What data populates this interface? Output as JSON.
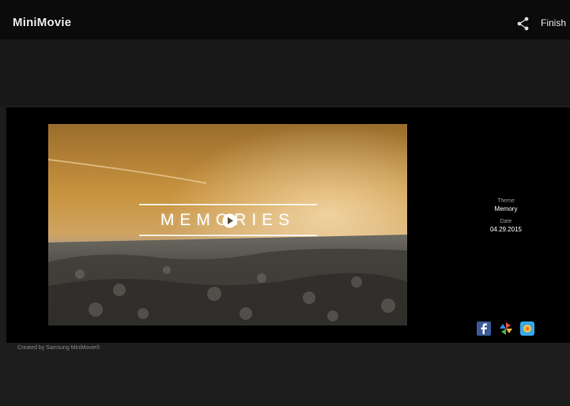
{
  "app": {
    "title": "MiniMovie",
    "finish_label": "Finish"
  },
  "video": {
    "overlay_title": "MEMORIES"
  },
  "info": {
    "theme_label": "Theme",
    "theme_value": "Memory",
    "date_label": "Date",
    "date_value": "04.29.2015"
  },
  "footer": {
    "credit": "Created by Samsung MiniMovie®"
  },
  "icons": {
    "share": "share-icon",
    "play": "play-icon",
    "facebook": "facebook-icon",
    "pinwheel": "pinwheel-icon",
    "photos": "photos-icon"
  },
  "colors": {
    "topbar": "#0b0b0b",
    "background": "#1d1d1d",
    "player": "#000000",
    "facebook": "#3b5998"
  }
}
